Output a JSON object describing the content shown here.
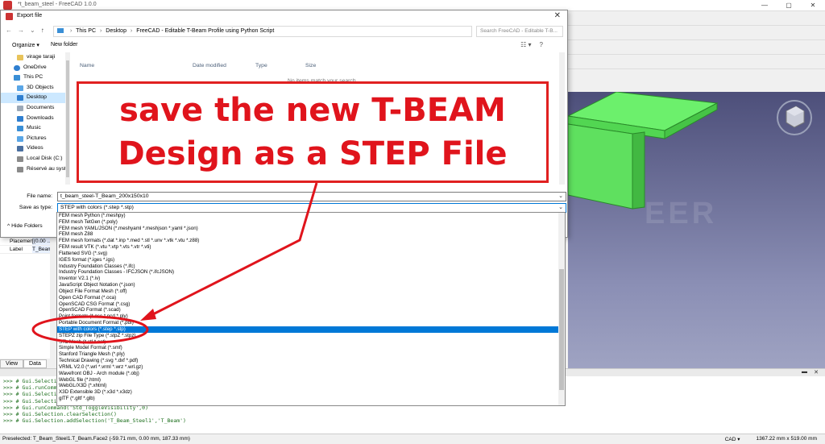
{
  "app": {
    "window_title": "*t_beam_steel - FreeCAD 1.0.0",
    "win_min": "—",
    "win_max": "▢",
    "win_close": "✕"
  },
  "dialog": {
    "title": "Export file",
    "close": "✕",
    "nav": {
      "back": "←",
      "forward": "→",
      "recent": "⌄",
      "up": "↑"
    },
    "address": {
      "root_icon": "desktop-icon",
      "crumbs": [
        "This PC",
        "Desktop",
        "FreeCAD - Editable T-Beam Profile using Python Script"
      ]
    },
    "search_placeholder": "Search FreeCAD - Editable T-B...",
    "organize": "Organize ▾",
    "new_folder": "New folder",
    "view_btns": [
      "☷ ▾",
      "?"
    ],
    "nav_items": [
      {
        "label": "virage taraji",
        "icon": "folder-icon",
        "top": false,
        "selected": false
      },
      {
        "label": "OneDrive",
        "icon": "cloud-icon",
        "top": true,
        "selected": false
      },
      {
        "label": "This PC",
        "icon": "computer-icon",
        "top": true,
        "selected": false
      },
      {
        "label": "3D Objects",
        "icon": "cube-icon",
        "top": false,
        "selected": false
      },
      {
        "label": "Desktop",
        "icon": "desktop-icon",
        "top": false,
        "selected": true
      },
      {
        "label": "Documents",
        "icon": "document-icon",
        "top": false,
        "selected": false
      },
      {
        "label": "Downloads",
        "icon": "download-icon",
        "top": false,
        "selected": false
      },
      {
        "label": "Music",
        "icon": "music-icon",
        "top": false,
        "selected": false
      },
      {
        "label": "Pictures",
        "icon": "picture-icon",
        "top": false,
        "selected": false
      },
      {
        "label": "Videos",
        "icon": "video-icon",
        "top": false,
        "selected": false
      },
      {
        "label": "Local Disk (C:)",
        "icon": "disk-icon",
        "top": false,
        "selected": false
      },
      {
        "label": "Réservé au systè",
        "icon": "disk-icon",
        "top": false,
        "selected": false
      }
    ],
    "columns": [
      "Name",
      "Date modified",
      "Type",
      "Size"
    ],
    "empty_message": "No items match your search.",
    "file_name_label": "File name:",
    "file_name_value": "t_beam_steel-T_Beam_200x150x10",
    "save_type_label": "Save as type:",
    "save_type_value": "STEP with colors (*.step *.stp)",
    "hide_folders": "^ Hide Folders",
    "type_options": [
      "FEM mesh Python (*.meshpy)",
      "FEM mesh TetGen (*.poly)",
      "FEM mesh YAML/JSON (*.meshyaml *.meshjson *.yaml *.json)",
      "FEM mesh Z88",
      "FEM mesh formats (*.dat *.inp *.med *.stl *.unv *.vtk *.vtu *.z88)",
      "FEM result VTK (*.vtu *.vtp *.vts *.vtr *.vti)",
      "Flattened SVG (*.svg)",
      "IGES format (*.iges *.igs)",
      "Industry Foundation Classes (*.ifc)",
      "Industry Foundation Classes - IFCJSON (*.ifcJSON)",
      "Inventor V2.1 (*.iv)",
      "JavaScript Object Notation (*.json)",
      "Object File Format Mesh (*.off)",
      "Open CAD Format (*.oca)",
      "OpenSCAD CSG Format (*.csg)",
      "OpenSCAD Format (*.scad)",
      "Point formats (*.asc *.pcd *.ply)",
      "Portable Document Format (*.pdf)",
      "STEP with colors (*.step *.stp)",
      "STEPZ zip File Type (*.stpZ *.stpz)",
      "STL Mesh (*.stl *.ast)",
      "Simple Model Format (*.smf)",
      "Stanford Triangle Mesh (*.ply)",
      "Technical Drawing (*.svg *.dxf *.pdf)",
      "VRML V2.0 (*.wrl *.vrml *.wrz *.wrl.gz)",
      "Wavefront OBJ - Arch module (*.obj)",
      "WebGL file (*.html)",
      "WebGL/X3D (*.xhtml)",
      "X3D Extensible 3D (*.x3d *.x3dz)",
      "glTF (*.gltf *.glb)"
    ],
    "selected_option_index": 18
  },
  "annotation": {
    "line1": "save the new T-BEAM",
    "line2": "Design as a STEP File",
    "color": "#e0141c"
  },
  "properties": {
    "rows": [
      {
        "key": "Placement",
        "value": "[(0.00 ..."
      },
      {
        "key": "Label",
        "value": "T_Beam"
      }
    ]
  },
  "bottom_tabs": [
    "View",
    "Data"
  ],
  "viewport": {
    "watermark": "EER"
  },
  "report": {
    "lines": [
      ">>> # Gui.Selection",
      ">>> # Gui.runComman",
      ">>> # Gui.Selectio",
      ">>> # Gui.Selectio",
      ">>> # Gui.runCommand('Std_ToggleVisibility',0)",
      ">>> # Gui.Selection.clearSelection()",
      ">>> # Gui.Selection.addSelection('T_Beam_Steel1','T_Beam')"
    ],
    "ctrl_min": "▬",
    "ctrl_close": "✕"
  },
  "status": {
    "preselected": "Preselected: T_Beam_Steel1.T_Beam.Face2 (-59.71 mm, 0.00 mm, 187.33 mm)",
    "nav_style": "CAD ▾",
    "dimensions": "1367.22 mm x 519.00 mm"
  }
}
